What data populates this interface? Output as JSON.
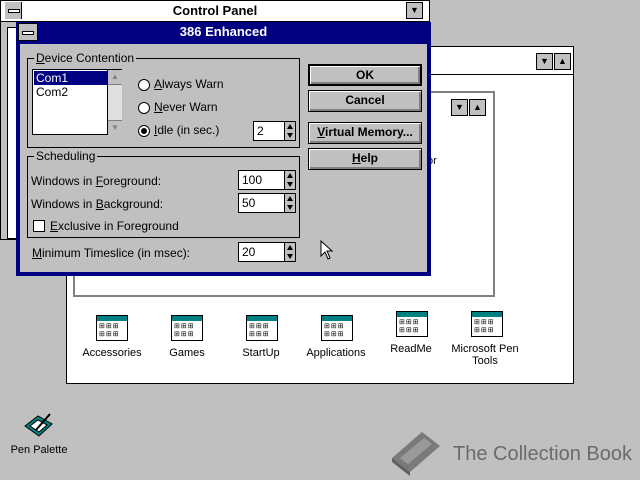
{
  "control_panel": {
    "title": "Control Panel"
  },
  "dialog": {
    "title": "386 Enhanced",
    "device_contention": {
      "title": "Device Contention",
      "ports": [
        "Com1",
        "Com2"
      ],
      "selected_port": "Com1",
      "options": [
        "Always Warn",
        "Never Warn",
        "Idle (in sec.)"
      ],
      "selected_option": "Idle (in sec.)",
      "idle_value": "2"
    },
    "scheduling": {
      "title": "Scheduling",
      "foreground_label": "Windows in Foreground:",
      "foreground_value": "100",
      "background_label": "Windows in Background:",
      "background_value": "50",
      "exclusive_label": "Exclusive in Foreground",
      "exclusive_checked": false
    },
    "timeslice_label": "Minimum Timeslice (in msec):",
    "timeslice_value": "20",
    "buttons": {
      "ok": "OK",
      "cancel": "Cancel",
      "virtual_memory": "Virtual Memory...",
      "help": "Help"
    }
  },
  "program_manager": {
    "partial_text": "or",
    "groups": [
      {
        "label": "Accessories"
      },
      {
        "label": "Games"
      },
      {
        "label": "StartUp"
      },
      {
        "label": "Applications"
      },
      {
        "label": "ReadMe"
      },
      {
        "label": "Microsoft Pen Tools"
      }
    ]
  },
  "desktop": {
    "pen_palette_label": "Pen Palette"
  },
  "watermark": {
    "text": "The Collection Book"
  }
}
